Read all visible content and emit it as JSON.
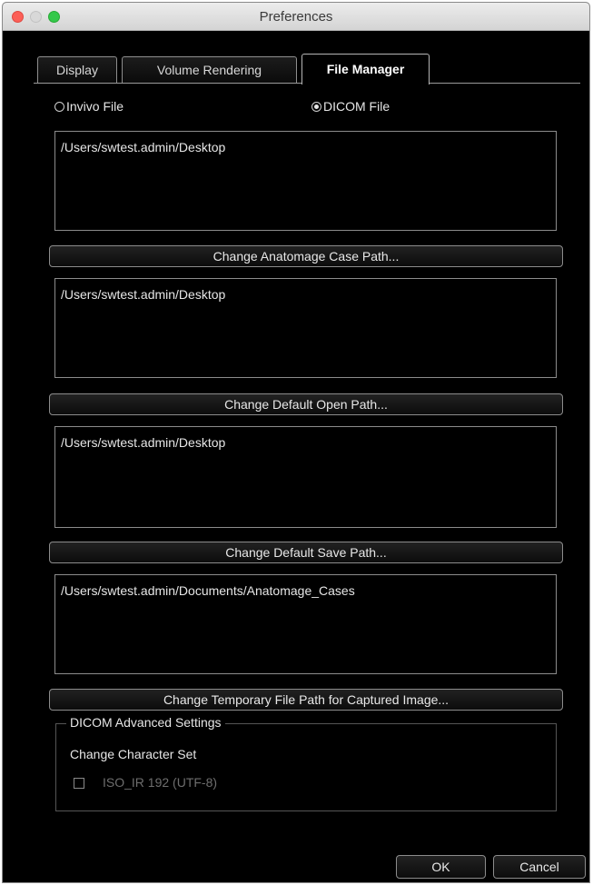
{
  "window": {
    "title": "Preferences"
  },
  "tabs": [
    {
      "label": "Display"
    },
    {
      "label": "Volume Rendering"
    },
    {
      "label": "File Manager"
    }
  ],
  "active_tab": "File Manager",
  "file_type": {
    "options": [
      {
        "label": "Invivo File",
        "selected": false
      },
      {
        "label": "DICOM File",
        "selected": true
      }
    ]
  },
  "paths": [
    {
      "value": "/Users/swtest.admin/Desktop",
      "button_label": "Change Anatomage Case Path..."
    },
    {
      "value": "/Users/swtest.admin/Desktop",
      "button_label": "Change Default Open Path..."
    },
    {
      "value": "/Users/swtest.admin/Desktop",
      "button_label": "Change Default Save Path..."
    },
    {
      "value": "/Users/swtest.admin/Documents/Anatomage_Cases",
      "button_label": "Change Temporary File Path for Captured Image..."
    }
  ],
  "dicom_advanced": {
    "group_label": "DICOM Advanced Settings",
    "charset_label": "Change Character Set",
    "checkbox_label": "ISO_IR 192 (UTF-8)",
    "checkbox_checked": false,
    "checkbox_enabled": false
  },
  "footer": {
    "ok_label": "OK",
    "cancel_label": "Cancel"
  },
  "colors": {
    "background": "#000000",
    "text": "#e6e6e6",
    "disabled_text": "#6e6e6e",
    "close": "#fc5f57",
    "maximize": "#34c84a"
  }
}
